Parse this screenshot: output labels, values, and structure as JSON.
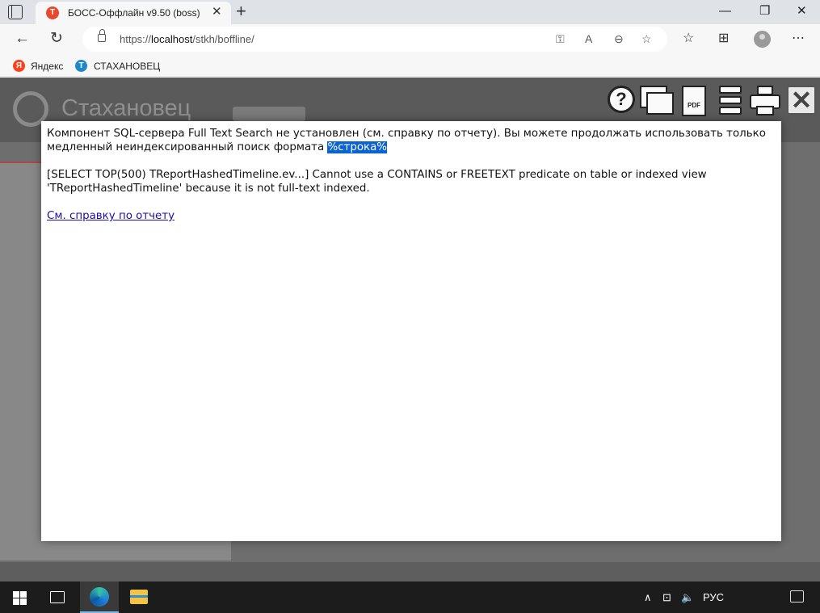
{
  "browser": {
    "tab_title": "БОСС-Оффлайн v9.50 (boss)",
    "url_prefix": "https://",
    "url_host": "localhost",
    "url_path": "/stkh/boffline/"
  },
  "favorites": [
    {
      "label": "Яндекс",
      "icon": "yandex-icon"
    },
    {
      "label": "СТАХАНОВЕЦ",
      "icon": "stakhanovets-icon"
    }
  ],
  "app": {
    "logo_text": "Стахановец"
  },
  "dialog": {
    "message_line1_main": "Компонент SQL-сервера Full Text Search не установлен (см. справку по отчету). Вы можете продолжать использовать только медленный неиндексированный поиск формата ",
    "message_line1_highlight": "%строка%",
    "message_error": "[SELECT TOP(500) TReportHashedTimeline.ev...] Cannot use a CONTAINS or FREETEXT predicate on table or indexed view 'TReportHashedTimeline' because it is not full-text indexed.",
    "help_link": "См. справку по отчету"
  },
  "taskbar": {
    "language": "РУС"
  },
  "colors": {
    "selection_highlight": "#0b63d1",
    "link": "#1a0dab",
    "taskbar": "#1c1c1c"
  }
}
